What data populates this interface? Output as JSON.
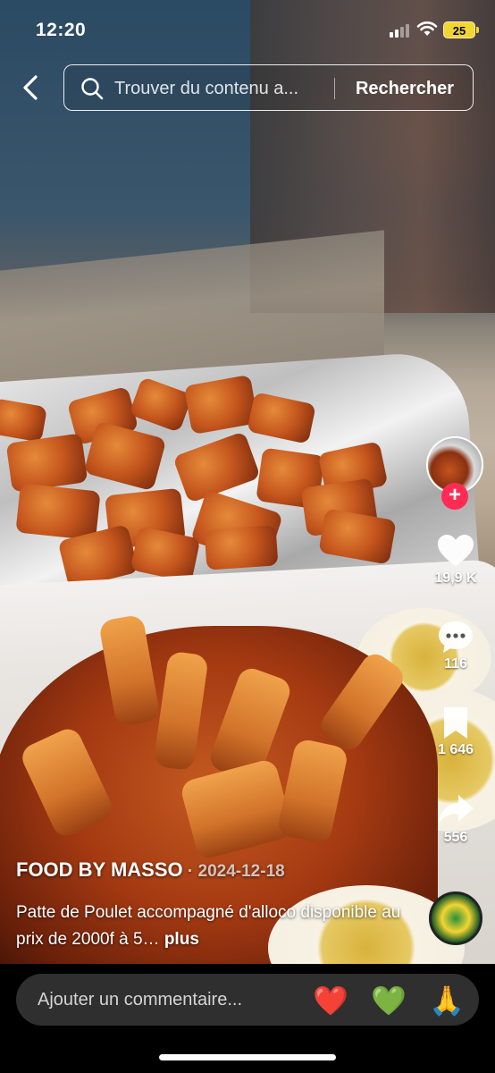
{
  "status_bar": {
    "time": "12:20",
    "battery": "25"
  },
  "search": {
    "placeholder": "Trouver du contenu a...",
    "button_label": "Rechercher"
  },
  "rail": {
    "likes": "19,9 K",
    "comments": "116",
    "bookmarks": "1 646",
    "shares": "556"
  },
  "post": {
    "author": "FOOD BY MASSO",
    "date_separator": " · ",
    "date": "2024-12-18",
    "description": "Patte de Poulet accompagné d'alloco disponible au prix de 2000f à 5…",
    "more_label": "plus"
  },
  "comment_bar": {
    "placeholder": "Ajouter un commentaire...",
    "emojis": [
      "❤️",
      "💚",
      "🙏"
    ]
  },
  "icons": {
    "back": "chevron-left-icon",
    "search": "search-icon",
    "like": "heart-icon",
    "comment": "chat-bubble-icon",
    "bookmark": "bookmark-icon",
    "share": "share-arrow-icon",
    "follow": "plus-icon"
  },
  "colors": {
    "follow_accent": "#fe2c55",
    "battery": "#f2d533"
  }
}
